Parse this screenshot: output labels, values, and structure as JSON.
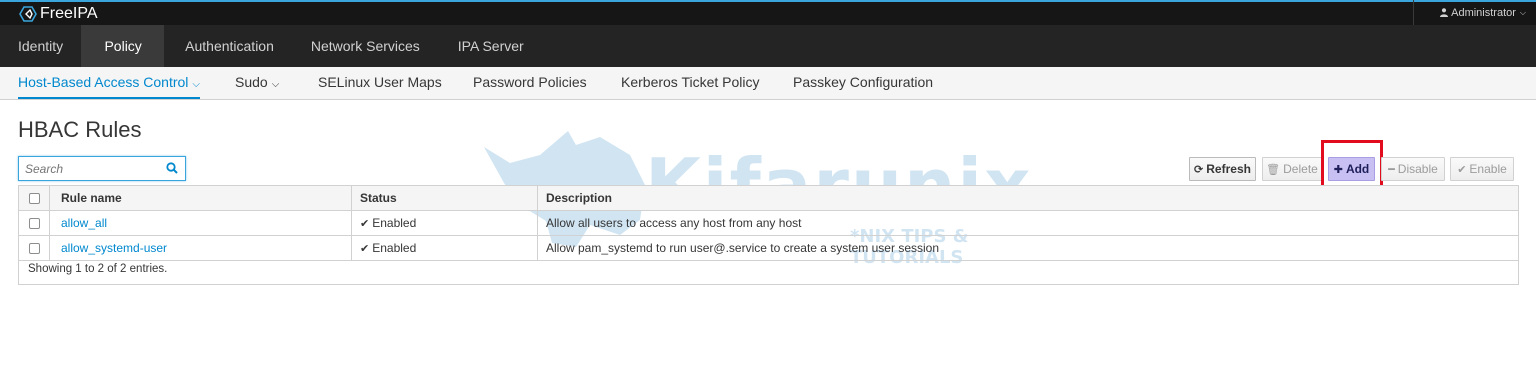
{
  "app": {
    "brand_name": "FreeIPA",
    "user_label": "Administrator"
  },
  "main_nav": [
    {
      "label": "Identity",
      "active": false
    },
    {
      "label": "Policy",
      "active": true
    },
    {
      "label": "Authentication",
      "active": false
    },
    {
      "label": "Network Services",
      "active": false
    },
    {
      "label": "IPA Server",
      "active": false
    }
  ],
  "sub_nav": [
    {
      "label": "Host-Based Access Control",
      "has_dropdown": true,
      "active": true
    },
    {
      "label": "Sudo",
      "has_dropdown": true,
      "active": false
    },
    {
      "label": "SELinux User Maps",
      "has_dropdown": false,
      "active": false
    },
    {
      "label": "Password Policies",
      "has_dropdown": false,
      "active": false
    },
    {
      "label": "Kerberos Ticket Policy",
      "has_dropdown": false,
      "active": false
    },
    {
      "label": "Passkey Configuration",
      "has_dropdown": false,
      "active": false
    }
  ],
  "page": {
    "title": "HBAC Rules"
  },
  "search": {
    "placeholder": "Search",
    "value": "",
    "icon": "search-icon"
  },
  "toolbar": {
    "refresh_label": "Refresh",
    "delete_label": "Delete",
    "add_label": "Add",
    "disable_label": "Disable",
    "enable_label": "Enable"
  },
  "table": {
    "columns": [
      "Rule name",
      "Status",
      "Description"
    ],
    "rows": [
      {
        "name": "allow_all",
        "status": "Enabled",
        "description": "Allow all users to access any host from any host"
      },
      {
        "name": "allow_systemd-user",
        "status": "Enabled",
        "description": "Allow pam_systemd to run user@.service to create a system user session"
      }
    ],
    "footer": "Showing 1 to 2 of 2 entries."
  },
  "watermark": {
    "brand": "Kifarunix",
    "tagline": "*NIX TIPS & TUTORIALS"
  },
  "colors": {
    "accent": "#0088ce",
    "highlight_box": "#e10d1f",
    "add_button_bg": "#c8c0f2"
  }
}
